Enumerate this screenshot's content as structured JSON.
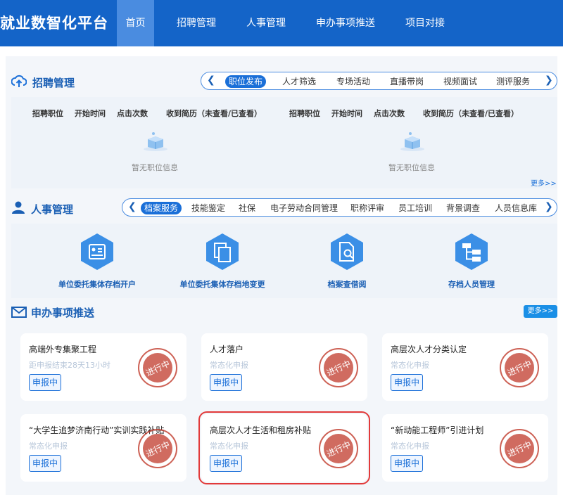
{
  "nav": {
    "brand": "就业数智化平台",
    "items": [
      "首页",
      "招聘管理",
      "人事管理",
      "申办事项推送",
      "项目对接"
    ]
  },
  "recruit": {
    "title": "招聘管理",
    "tabs": [
      "职位发布",
      "人才筛选",
      "专场活动",
      "直播带岗",
      "视频面试",
      "测评服务"
    ],
    "columns": [
      "招聘职位",
      "开始时间",
      "点击次数",
      "收到简历（未查看/已查看）"
    ],
    "empty": "暂无职位信息",
    "more": "更多>>"
  },
  "hr": {
    "title": "人事管理",
    "tabs": [
      "档案服务",
      "技能鉴定",
      "社保",
      "电子劳动合同管理",
      "职称评审",
      "员工培训",
      "背景调查",
      "人员信息库"
    ],
    "services": [
      "单位委托集体存档开户",
      "单位委托集体存档地变更",
      "档案查借阅",
      "存档人员管理"
    ]
  },
  "push": {
    "title": "申办事项推送",
    "more": "更多>>",
    "stamp_text": "进行中",
    "cards": [
      {
        "title": "高端外专集聚工程",
        "sub": "距申报结束28天13小时",
        "badge": "申报中"
      },
      {
        "title": "人才落户",
        "sub": "常态化申报",
        "badge": "申报中"
      },
      {
        "title": "高层次人才分类认定",
        "sub": "常态化申报",
        "badge": "申报中"
      },
      {
        "title": "“大学生追梦济南行动”实训实践补贴",
        "sub": "常态化申报",
        "badge": "申报中"
      },
      {
        "title": "高层次人才生活和租房补贴",
        "sub": "常态化申报",
        "badge": "申报中"
      },
      {
        "title": "“新动能工程师”引进计划",
        "sub": "常态化申报",
        "badge": "申报中"
      }
    ]
  },
  "colors": {
    "primary": "#1464c8",
    "accent": "#1a6fd8",
    "highlight": "#e23a3a",
    "stamp": "#c0392b"
  }
}
